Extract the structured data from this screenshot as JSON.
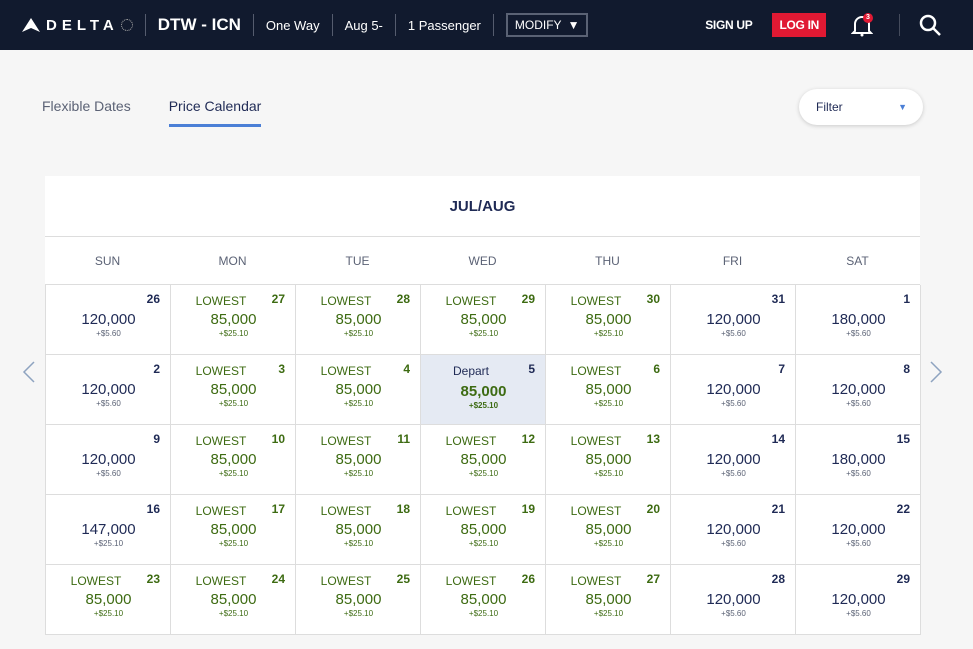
{
  "nav": {
    "brand": "DELTA",
    "route": "DTW - ICN",
    "trip": "One Way",
    "dates": "Aug 5-",
    "passengers": "1 Passenger",
    "modify": "MODIFY",
    "signup": "SIGN UP",
    "login": "LOG IN",
    "notifications": "3"
  },
  "tabs": [
    {
      "label": "Flexible Dates"
    },
    {
      "label": "Price Calendar",
      "active": true
    }
  ],
  "filter": {
    "label": "Filter"
  },
  "calendar": {
    "month": "JUL/AUG",
    "days": [
      "SUN",
      "MON",
      "TUE",
      "WED",
      "THU",
      "FRI",
      "SAT"
    ],
    "weeks": [
      [
        {
          "d": "26",
          "p": "120,000",
          "t": "+$5.60"
        },
        {
          "d": "27",
          "p": "85,000",
          "t": "+$25.10",
          "low": true
        },
        {
          "d": "28",
          "p": "85,000",
          "t": "+$25.10",
          "low": true
        },
        {
          "d": "29",
          "p": "85,000",
          "t": "+$25.10",
          "low": true
        },
        {
          "d": "30",
          "p": "85,000",
          "t": "+$25.10",
          "low": true
        },
        {
          "d": "31",
          "p": "120,000",
          "t": "+$5.60"
        },
        {
          "d": "1",
          "p": "180,000",
          "t": "+$5.60"
        }
      ],
      [
        {
          "d": "2",
          "p": "120,000",
          "t": "+$5.60"
        },
        {
          "d": "3",
          "p": "85,000",
          "t": "+$25.10",
          "low": true
        },
        {
          "d": "4",
          "p": "85,000",
          "t": "+$25.10",
          "low": true
        },
        {
          "d": "5",
          "p": "85,000",
          "t": "+$25.10",
          "sel": true,
          "label": "Depart"
        },
        {
          "d": "6",
          "p": "85,000",
          "t": "+$25.10",
          "low": true
        },
        {
          "d": "7",
          "p": "120,000",
          "t": "+$5.60"
        },
        {
          "d": "8",
          "p": "120,000",
          "t": "+$5.60"
        }
      ],
      [
        {
          "d": "9",
          "p": "120,000",
          "t": "+$5.60"
        },
        {
          "d": "10",
          "p": "85,000",
          "t": "+$25.10",
          "low": true
        },
        {
          "d": "11",
          "p": "85,000",
          "t": "+$25.10",
          "low": true
        },
        {
          "d": "12",
          "p": "85,000",
          "t": "+$25.10",
          "low": true
        },
        {
          "d": "13",
          "p": "85,000",
          "t": "+$25.10",
          "low": true
        },
        {
          "d": "14",
          "p": "120,000",
          "t": "+$5.60"
        },
        {
          "d": "15",
          "p": "180,000",
          "t": "+$5.60"
        }
      ],
      [
        {
          "d": "16",
          "p": "147,000",
          "t": "+$25.10"
        },
        {
          "d": "17",
          "p": "85,000",
          "t": "+$25.10",
          "low": true
        },
        {
          "d": "18",
          "p": "85,000",
          "t": "+$25.10",
          "low": true
        },
        {
          "d": "19",
          "p": "85,000",
          "t": "+$25.10",
          "low": true
        },
        {
          "d": "20",
          "p": "85,000",
          "t": "+$25.10",
          "low": true
        },
        {
          "d": "21",
          "p": "120,000",
          "t": "+$5.60"
        },
        {
          "d": "22",
          "p": "120,000",
          "t": "+$5.60"
        }
      ],
      [
        {
          "d": "23",
          "p": "85,000",
          "t": "+$25.10",
          "low": true
        },
        {
          "d": "24",
          "p": "85,000",
          "t": "+$25.10",
          "low": true
        },
        {
          "d": "25",
          "p": "85,000",
          "t": "+$25.10",
          "low": true
        },
        {
          "d": "26",
          "p": "85,000",
          "t": "+$25.10",
          "low": true
        },
        {
          "d": "27",
          "p": "85,000",
          "t": "+$25.10",
          "low": true
        },
        {
          "d": "28",
          "p": "120,000",
          "t": "+$5.60"
        },
        {
          "d": "29",
          "p": "120,000",
          "t": "+$5.60"
        }
      ]
    ],
    "lowest_label": "LOWEST"
  }
}
